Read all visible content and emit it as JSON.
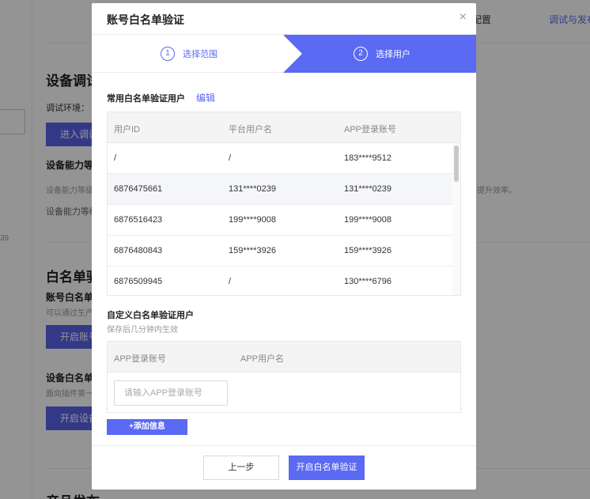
{
  "background": {
    "header_right_1": "配置",
    "header_right_2": "调试与发布",
    "device_debug_title": "设备调试",
    "debug_env_label": "调试环境：",
    "enter_debug_btn": "进入调试",
    "device_capability_title": "设备能力等",
    "capability_desc_1": "设备能力等级",
    "capability_desc_end": "提升效率。",
    "capability_desc_2": "设备能力等级",
    "side_number": "39",
    "whitelist_title": "白名单验",
    "account_whitelist_title": "账号白名单",
    "account_whitelist_desc": "可以通过生产",
    "open_account_btn": "开启账号",
    "device_whitelist_title": "设备白名单",
    "device_whitelist_desc": "面向插件第一",
    "open_device_btn": "开启设备",
    "publish_title": "产品发布"
  },
  "modal": {
    "title": "账号白名单验证",
    "close_icon": "×",
    "steps": [
      {
        "num": "1",
        "label": "选择范围"
      },
      {
        "num": "2",
        "label": "选择用户"
      }
    ],
    "common_section_title": "常用白名单验证用户",
    "edit_link": "编辑",
    "common_table": {
      "headers": [
        "用户ID",
        "平台用户名",
        "APP登录账号"
      ],
      "rows": [
        [
          "/",
          "/",
          "183****9512"
        ],
        [
          "6876475661",
          "131****0239",
          "131****0239"
        ],
        [
          "6876516423",
          "199****9008",
          "199****9008"
        ],
        [
          "6876480843",
          "159****3926",
          "159****3926"
        ],
        [
          "6876509945",
          "/",
          "130****6796"
        ]
      ]
    },
    "custom_section_title": "自定义白名单验证用户",
    "custom_hint": "保存后几分钟内生效",
    "custom_table": {
      "headers": [
        "APP登录账号",
        "APP用户名"
      ],
      "input_placeholder": "请输入APP登录账号",
      "input_value": ""
    },
    "add_info_btn": "+添加信息",
    "prev_btn": "上一步",
    "next_btn": "开启白名单验证"
  },
  "colors": {
    "accent": "#5a6af3",
    "overlay": "rgba(0,0,0,0.42)"
  }
}
